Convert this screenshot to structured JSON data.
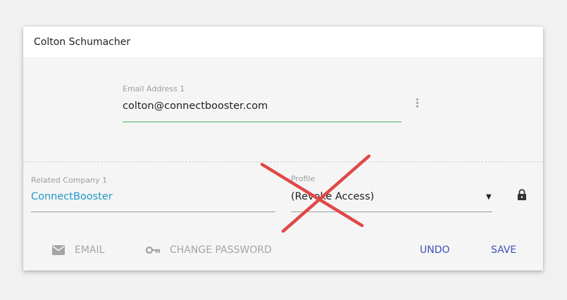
{
  "card": {
    "title": "Colton Schumacher"
  },
  "email_field": {
    "label": "Email Address 1",
    "value": "colton@connectbooster.com"
  },
  "company_field": {
    "label": "Related Company 1",
    "value": "ConnectBooster"
  },
  "profile_field": {
    "label": "Profile",
    "value": "(Revoke Access)"
  },
  "actions": {
    "email": "EMAIL",
    "change_password": "CHANGE PASSWORD",
    "undo": "UNDO",
    "save": "SAVE"
  },
  "colors": {
    "accent_green": "#4caf50",
    "link_blue": "#2196c9",
    "primary_indigo": "#3f51b5",
    "annotation_red": "#e04848"
  },
  "icons": [
    "kebab-menu-icon",
    "lock-icon",
    "email-icon",
    "key-icon"
  ]
}
